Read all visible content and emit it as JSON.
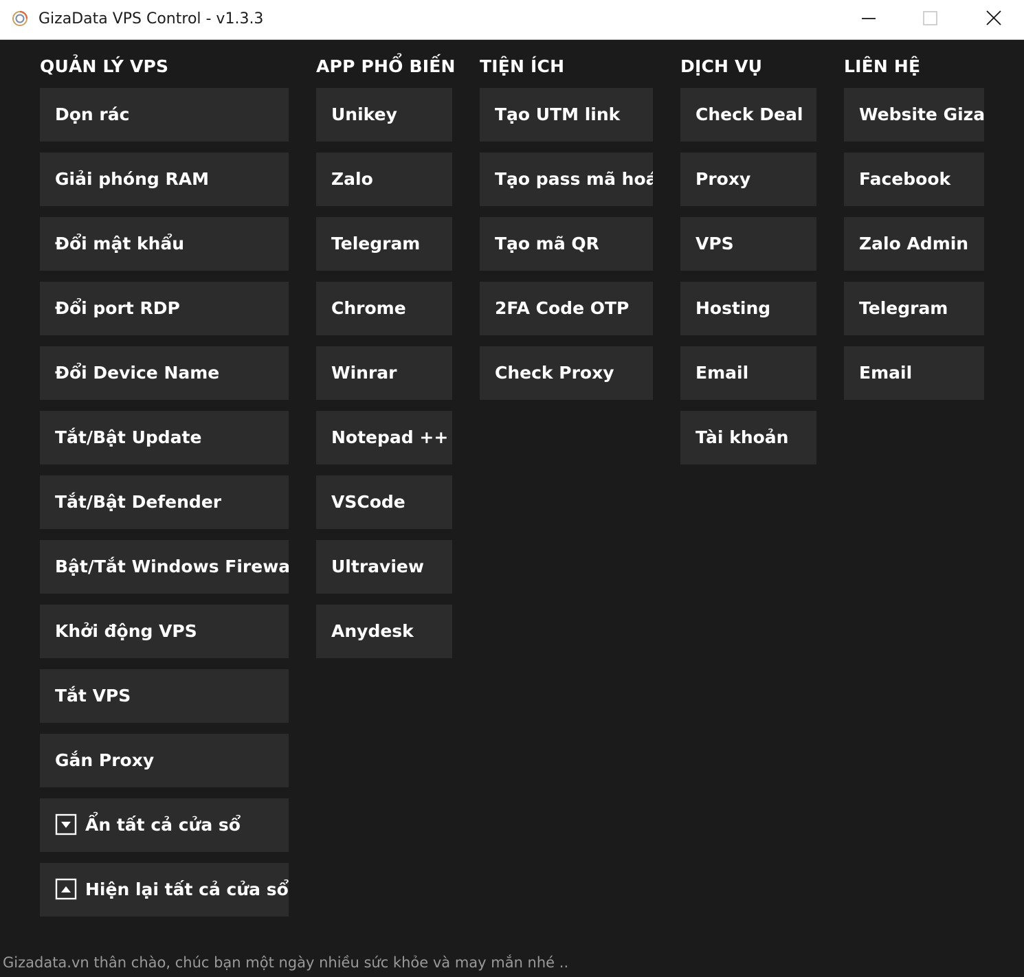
{
  "window": {
    "title": "GizaData VPS Control - v1.3.3"
  },
  "sections": {
    "vps": {
      "heading": "QUẢN LÝ VPS",
      "buttons": [
        "Dọn rác",
        "Giải phóng RAM",
        "Đổi mật khẩu",
        "Đổi port RDP",
        "Đổi Device Name",
        "Tắt/Bật Update",
        "Tắt/Bật Defender",
        "Bật/Tắt Windows Firewall",
        "Khởi động VPS",
        "Tắt VPS",
        "Gắn Proxy",
        "Ẩn tất cả cửa sổ",
        "Hiện lại tất cả cửa sổ"
      ]
    },
    "apps": {
      "heading": "APP PHỔ BIẾN",
      "buttons": [
        "Unikey",
        "Zalo",
        "Telegram",
        "Chrome",
        "Winrar",
        "Notepad ++",
        "VSCode",
        "Ultraview",
        "Anydesk"
      ]
    },
    "utilities": {
      "heading": "TIỆN ÍCH",
      "buttons": [
        "Tạo UTM link",
        "Tạo pass mã hoá",
        "Tạo mã QR",
        "2FA Code OTP",
        "Check Proxy"
      ]
    },
    "services": {
      "heading": "DỊCH VỤ",
      "buttons": [
        "Check Deal",
        "Proxy",
        "VPS",
        "Hosting",
        "Email",
        "Tài khoản"
      ]
    },
    "contact": {
      "heading": "LIÊN HỆ",
      "buttons": [
        "Website Giza",
        "Facebook",
        "Zalo Admin",
        "Telegram",
        "Email"
      ]
    }
  },
  "status_text": "Gizadata.vn thân chào, chúc bạn một ngày nhiều sức khỏe và may mắn nhé ..",
  "icons": {
    "app": "gizadata-logo-icon",
    "minimize": "minimize-icon",
    "maximize": "maximize-icon",
    "close": "close-icon",
    "hide_all": "arrow-down-box-icon",
    "show_all": "arrow-up-box-icon"
  },
  "colors": {
    "background": "#1b1b1b",
    "button": "#2c2c2c",
    "text": "#ffffff",
    "status_text": "#9a9a9a",
    "titlebar": "#ffffff"
  }
}
